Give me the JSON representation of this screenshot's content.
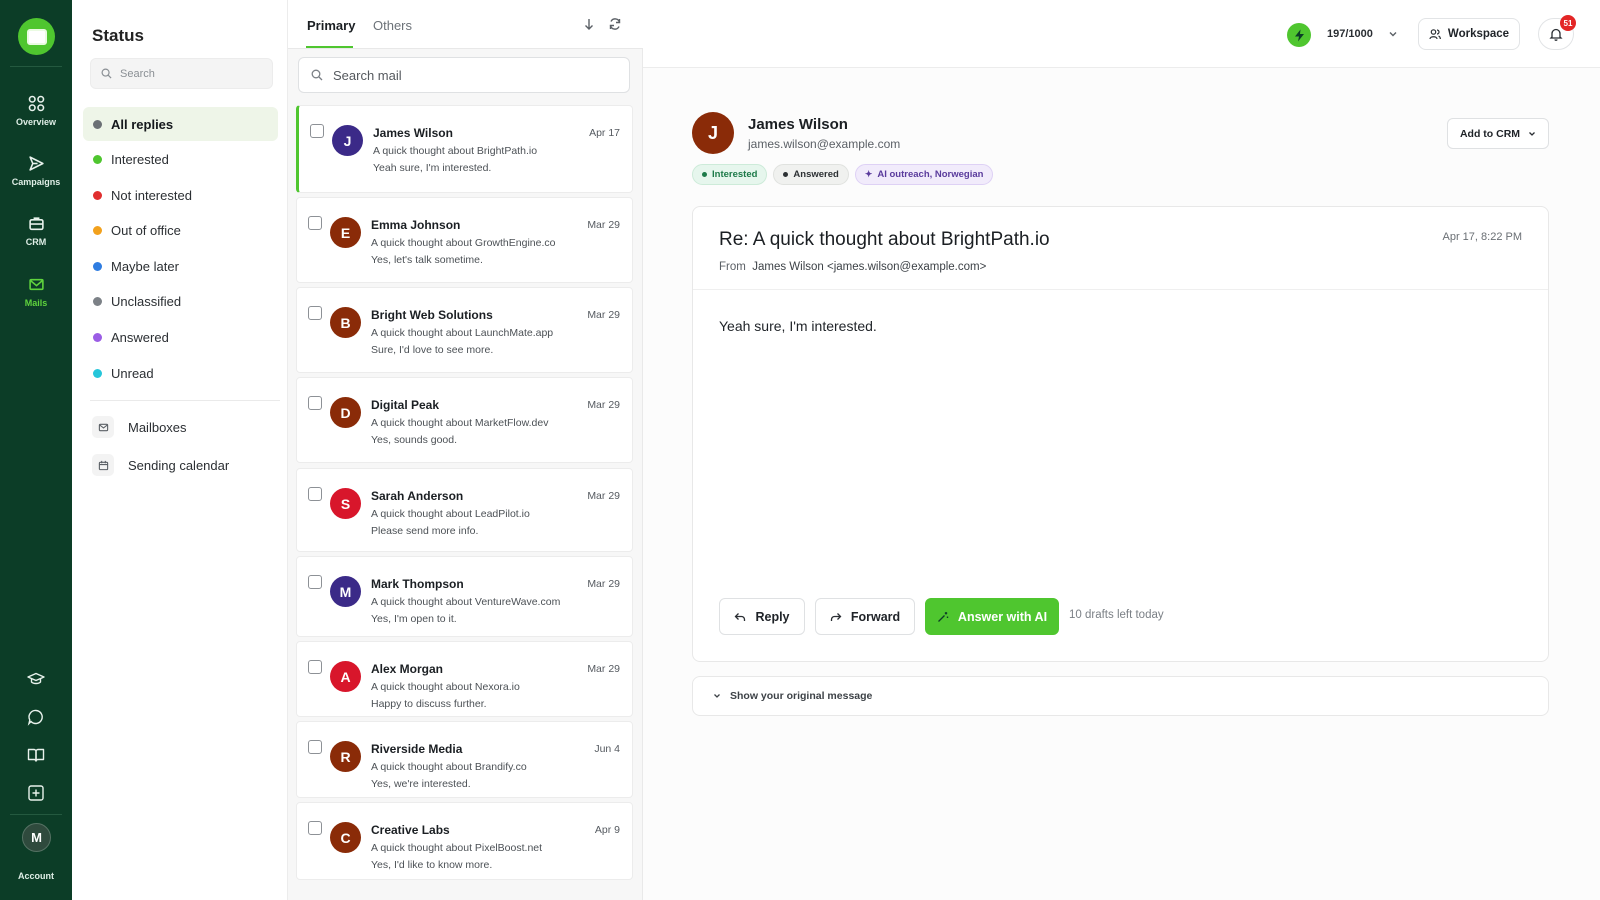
{
  "nav": {
    "items": [
      {
        "label": "Overview",
        "icon": "grid-icon"
      },
      {
        "label": "Campaigns",
        "icon": "send-icon"
      },
      {
        "label": "CRM",
        "icon": "briefcase-icon"
      },
      {
        "label": "Mails",
        "icon": "mail-icon",
        "active": true
      }
    ],
    "tools": [
      "graduation-cap-icon",
      "chat-icon",
      "book-icon",
      "add-square-icon"
    ],
    "account": {
      "initial": "M",
      "label": "Account"
    }
  },
  "status_panel": {
    "title": "Status",
    "search_placeholder": "Search",
    "items": [
      {
        "label": "All replies",
        "color": "#6b7075",
        "active": true
      },
      {
        "label": "Interested",
        "color": "#4fc62f"
      },
      {
        "label": "Not interested",
        "color": "#e02f2f"
      },
      {
        "label": "Out of office",
        "color": "#f2a11d"
      },
      {
        "label": "Maybe later",
        "color": "#2f7de1"
      },
      {
        "label": "Unclassified",
        "color": "#7c8187"
      },
      {
        "label": "Answered",
        "color": "#9b5de5"
      },
      {
        "label": "Unread",
        "color": "#26c6da"
      }
    ],
    "utilities": [
      {
        "label": "Mailboxes",
        "icon": "mailbox-icon"
      },
      {
        "label": "Sending calendar",
        "icon": "calendar-icon"
      }
    ]
  },
  "mail_list": {
    "tabs": [
      {
        "label": "Primary",
        "active": true
      },
      {
        "label": "Others"
      }
    ],
    "search_placeholder": "Search mail",
    "mails": [
      {
        "initial": "J",
        "name": "James Wilson",
        "date": "Apr 17",
        "subject": "A quick thought about BrightPath.io",
        "preview": "Yeah sure, I'm interested.",
        "color": "#3b2a88",
        "active": true
      },
      {
        "initial": "E",
        "name": "Emma Johnson",
        "date": "Mar 29",
        "subject": "A quick thought about GrowthEngine.co",
        "preview": "Yes, let's talk sometime.",
        "color": "#8a2b08"
      },
      {
        "initial": "B",
        "name": "Bright Web Solutions",
        "date": "Mar 29",
        "subject": "A quick thought about LaunchMate.app",
        "preview": "Sure, I'd love to see more.",
        "color": "#8a2b08"
      },
      {
        "initial": "D",
        "name": "Digital Peak",
        "date": "Mar 29",
        "subject": "A quick thought about MarketFlow.dev",
        "preview": "Yes, sounds good.",
        "color": "#8a2b08"
      },
      {
        "initial": "S",
        "name": "Sarah Anderson",
        "date": "Mar 29",
        "subject": "A quick thought about LeadPilot.io",
        "preview": "Please send more info.",
        "color": "#d8162b"
      },
      {
        "initial": "M",
        "name": "Mark Thompson",
        "date": "Mar 29",
        "subject": "A quick thought about VentureWave.com",
        "preview": "Yes, I'm open to it.",
        "color": "#3b2a88"
      },
      {
        "initial": "A",
        "name": "Alex Morgan",
        "date": "Mar 29",
        "subject": "A quick thought about Nexora.io",
        "preview": "Happy to discuss further.",
        "color": "#d8162b"
      },
      {
        "initial": "R",
        "name": "Riverside Media",
        "date": "Jun 4",
        "subject": "A quick thought about Brandify.co",
        "preview": "Yes, we're interested.",
        "color": "#8a2b08"
      },
      {
        "initial": "C",
        "name": "Creative Labs",
        "date": "Apr 9",
        "subject": "A quick thought about PixelBoost.net",
        "preview": "Yes, I'd like to know more.",
        "color": "#8a2b08"
      }
    ]
  },
  "topbar": {
    "credits": "197/1000",
    "workspace_label": "Workspace",
    "notification_count": "51"
  },
  "detail": {
    "sender_initial": "J",
    "sender_name": "James Wilson",
    "sender_email": "james.wilson@example.com",
    "tags": [
      {
        "label": "Interested",
        "type": "interested"
      },
      {
        "label": "Answered",
        "type": "answered"
      },
      {
        "label": "AI outreach, Norwegian",
        "type": "ai"
      }
    ],
    "add_to_crm_label": "Add to CRM",
    "subject": "Re: A quick thought about BrightPath.io",
    "date": "Apr 17, 8:22 PM",
    "from_label": "From",
    "from_value": "James Wilson <james.wilson@example.com>",
    "body": "Yeah sure, I'm interested.",
    "reply_label": "Reply",
    "forward_label": "Forward",
    "answer_ai_label": "Answer with AI",
    "drafts_left": "10 drafts left today",
    "show_original_label": "Show your original message"
  },
  "colors": {
    "brand": "#4fc62f",
    "rail": "#0c3d27"
  }
}
